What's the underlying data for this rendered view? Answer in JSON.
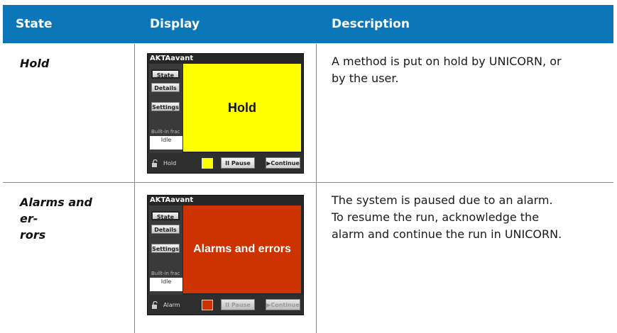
{
  "table": {
    "headers": [
      "State",
      "Display",
      "Description"
    ],
    "rows": [
      {
        "state": "Hold",
        "description_lines": [
          "A method is put on hold by UNICORN, or",
          "by the user."
        ],
        "display": {
          "title": "AKTAavant",
          "side_buttons": [
            "State",
            "Details",
            "Settings"
          ],
          "builtin_label": "Built-in frac",
          "idle_label": "Idle",
          "screen_text": "Hold",
          "screen_color": "#ffff00",
          "screen_text_color": "#111111",
          "status_label": "Hold",
          "swatch_color": "#ffff00",
          "pause_label": "II Pause",
          "continue_label": "▶Continue",
          "buttons_enabled": true
        }
      },
      {
        "state_lines": [
          "Alarms and er-",
          "rors"
        ],
        "description_lines": [
          "The system is paused due to an alarm.",
          "To resume the run, acknowledge the",
          "alarm and continue the run in UNICORN."
        ],
        "display": {
          "title": "AKTAavant",
          "side_buttons": [
            "State",
            "Details",
            "Settings"
          ],
          "builtin_label": "Built-in frac",
          "idle_label": "Idle",
          "screen_text": "Alarms and errors",
          "screen_color": "#cc3300",
          "screen_text_color": "#ffffff",
          "status_label": "Alarm",
          "swatch_color": "#cc3300",
          "pause_label": "II Pause",
          "continue_label": "▶Continue",
          "buttons_enabled": false
        }
      }
    ]
  },
  "icons": {
    "lock": "lock-icon"
  }
}
